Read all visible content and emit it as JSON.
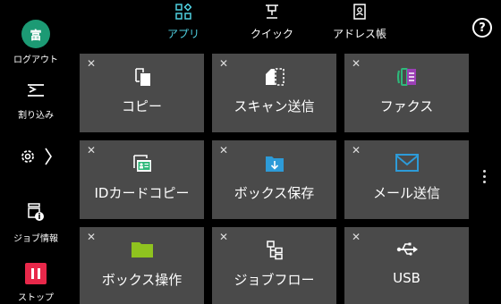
{
  "sidebar": {
    "logout_icon_text": "富",
    "logout_label": "ログアウト",
    "interrupt_label": "割り込み",
    "job_status_label": "ジョブ情報",
    "stop_label": "ストップ"
  },
  "tabs": [
    {
      "label": "アプリ",
      "icon": "apps-grid-icon",
      "active": true
    },
    {
      "label": "クイック",
      "icon": "quick-icon",
      "active": false
    },
    {
      "label": "アドレス帳",
      "icon": "address-book-icon",
      "active": false
    }
  ],
  "help_label": "?",
  "tiles": [
    {
      "label": "コピー",
      "icon": "copy-icon"
    },
    {
      "label": "スキャン送信",
      "icon": "scan-send-icon"
    },
    {
      "label": "ファクス",
      "icon": "fax-icon"
    },
    {
      "label": "IDカードコピー",
      "icon": "id-card-copy-icon"
    },
    {
      "label": "ボックス保存",
      "icon": "box-save-icon"
    },
    {
      "label": "メール送信",
      "icon": "email-send-icon"
    },
    {
      "label": "ボックス操作",
      "icon": "box-operation-icon"
    },
    {
      "label": "ジョブフロー",
      "icon": "job-flow-icon"
    },
    {
      "label": "USB",
      "icon": "usb-icon"
    }
  ],
  "colors": {
    "active_tab": "#4fd0e0",
    "logout": "#1c9a74",
    "stop": "#e8284a",
    "tile_bg": "#4a4a4a",
    "folder_green": "#8fc31f",
    "box_blue": "#2d9bd8",
    "fax_green": "#2eb87a",
    "fax_purple": "#9b3fb5"
  }
}
